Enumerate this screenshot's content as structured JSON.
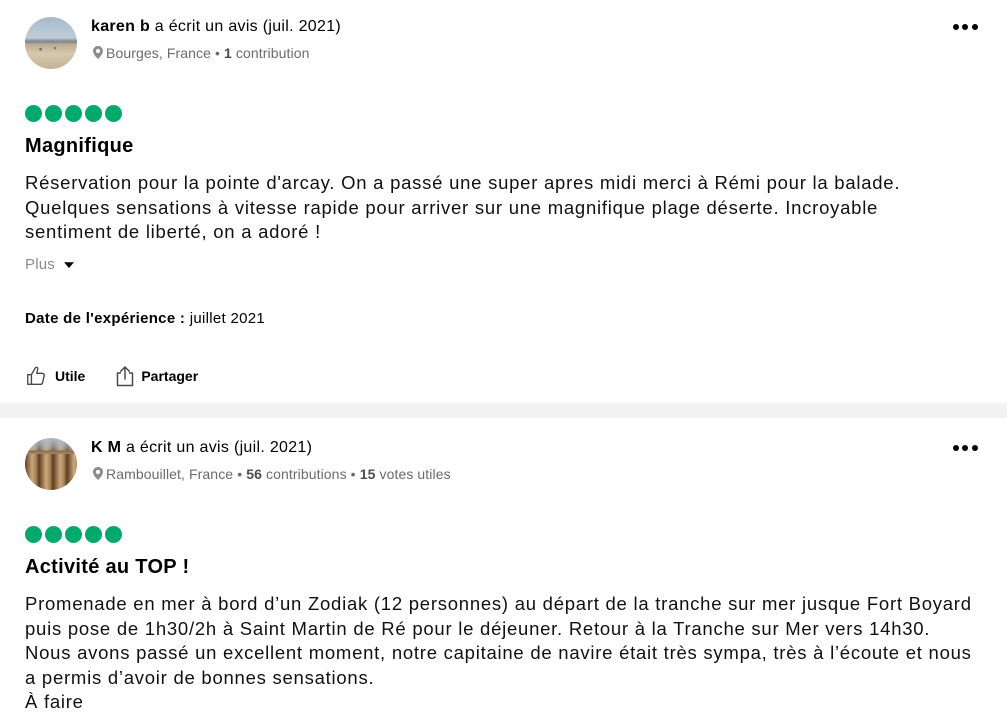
{
  "separator": "•",
  "icons": {
    "location": "pin-icon",
    "more_options": "more-options-icon",
    "expand": "caret-down-icon",
    "helpful": "thumbs-up-icon",
    "share": "share-icon",
    "rating_bubble": "rating-bubble"
  },
  "colors": {
    "rating_fill": "#00aa6c",
    "text_primary": "#000000",
    "text_secondary": "#6b6b6b",
    "text_muted": "#8c8c8c",
    "divider": "#f2f2f2"
  },
  "reviews": [
    {
      "author_name": "karen b",
      "action_text": "a écrit un avis (juil. 2021)",
      "author_location": "Bourges, France",
      "author_stats": [
        {
          "count": "1",
          "label": "contribution"
        }
      ],
      "rating": 5,
      "rating_max": 5,
      "title": "Magnifique",
      "body_lines": [
        "Réservation pour la pointe d'arcay. On a passé une super apres midi merci à Rémi pour la balade.",
        "Quelques sensations à vitesse rapide pour arriver sur une magnifique plage déserte. Incroyable",
        "sentiment de liberté, on a adoré !"
      ],
      "more_label": "Plus",
      "experience_date_label": "Date de l'expérience :",
      "experience_date": "juillet 2021",
      "helpful_label": "Utile",
      "share_label": "Partager"
    },
    {
      "author_name": "K M",
      "action_text": "a écrit un avis (juil. 2021)",
      "author_location": "Rambouillet, France",
      "author_stats": [
        {
          "count": "56",
          "label": "contributions"
        },
        {
          "count": "15",
          "label": "votes utiles"
        }
      ],
      "rating": 5,
      "rating_max": 5,
      "title": "Activité au TOP !",
      "body_lines": [
        "Promenade en mer à bord d’un Zodiak (12 personnes) au départ de la tranche sur mer jusque Fort Boyard",
        "puis pose de 1h30/2h à Saint Martin de Ré pour le déjeuner. Retour à la Tranche sur Mer vers 14h30.",
        "Nous avons passé un excellent moment, notre capitaine de navire était très sympa, très à l’écoute et nous",
        "a permis d’avoir de bonnes sensations.",
        "À faire"
      ]
    }
  ]
}
